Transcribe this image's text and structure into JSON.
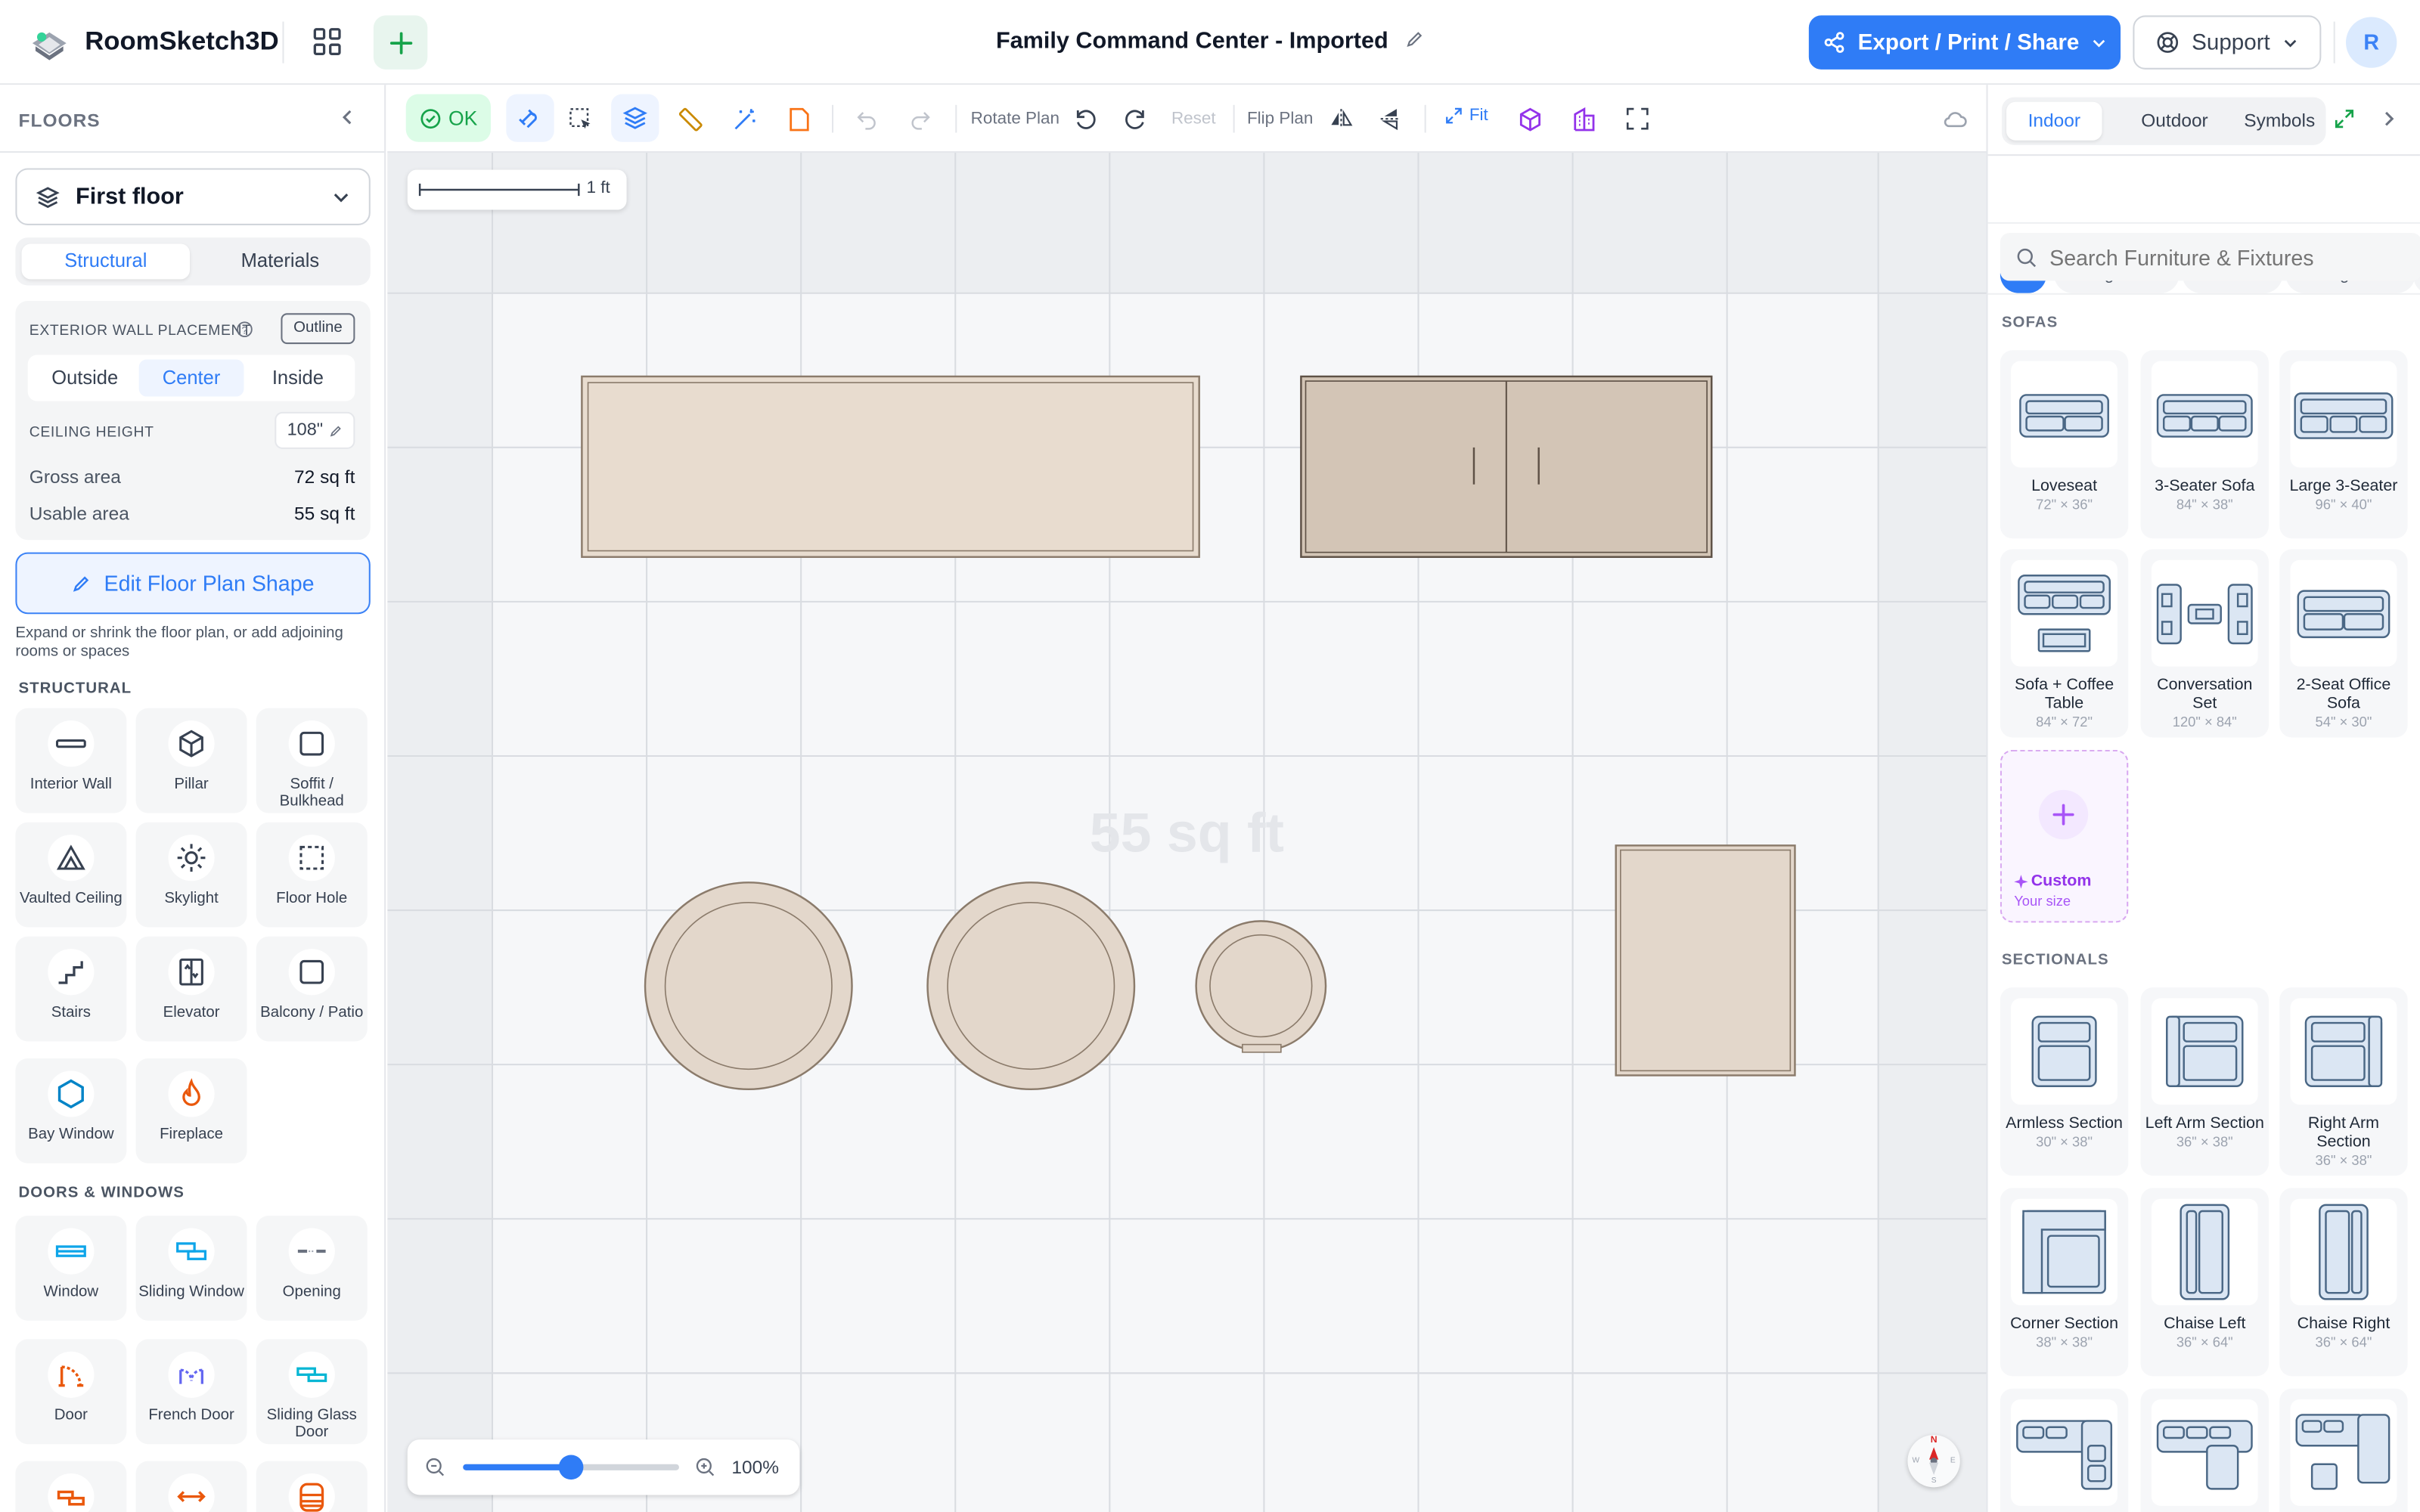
{
  "app": {
    "name": "RoomSketch3D",
    "doc_title": "Family Command Center - Imported",
    "avatar": "R"
  },
  "header": {
    "export_label": "Export / Print / Share",
    "support_label": "Support"
  },
  "left": {
    "floors_label": "FLOORS",
    "floor_select": "First floor",
    "tabs": [
      "Structural",
      "Materials"
    ],
    "wall_placement_label": "EXTERIOR WALL PLACEMENT",
    "outline_label": "Outline",
    "placement_options": [
      "Outside",
      "Center",
      "Inside"
    ],
    "ceiling_label": "CEILING HEIGHT",
    "ceiling_value": "108\"",
    "gross_label": "Gross area",
    "gross_value": "72 sq ft",
    "usable_label": "Usable area",
    "usable_value": "55 sq ft",
    "edit_button": "Edit Floor Plan Shape",
    "edit_hint": "Expand or shrink the floor plan, or add adjoining rooms or spaces",
    "structural_label": "STRUCTURAL",
    "structural_items": [
      "Interior Wall",
      "Pillar",
      "Soffit / Bulkhead",
      "Vaulted Ceiling",
      "Skylight",
      "Floor Hole",
      "Stairs",
      "Elevator",
      "Balcony / Patio",
      "Bay Window",
      "Fireplace"
    ],
    "doors_label": "DOORS & WINDOWS",
    "door_items": [
      "Window",
      "Sliding Window",
      "Opening",
      "Door",
      "French Door",
      "Sliding Glass Door"
    ]
  },
  "toolbar": {
    "ok": "OK",
    "rotate_label": "Rotate Plan",
    "reset_label": "Reset",
    "flip_label": "Flip Plan",
    "fit_label": "Fit"
  },
  "canvas": {
    "scale_label": "1 ft",
    "area_watermark": "55 sq ft",
    "zoom": "100%",
    "zoom_fraction": 0.5,
    "compass": {
      "n": "N",
      "w": "W",
      "e": "E",
      "s": "S"
    }
  },
  "right": {
    "tabs": [
      "Indoor",
      "Outdoor",
      "Symbols"
    ],
    "chips": [
      "All",
      "Living Room",
      "Bedroom",
      "Dining Room"
    ],
    "search_placeholder": "Search Furniture & Fixtures",
    "sofas_label": "SOFAS",
    "sofas": [
      {
        "name": "Loveseat",
        "dims": "72\" × 36\""
      },
      {
        "name": "3-Seater Sofa",
        "dims": "84\" × 38\""
      },
      {
        "name": "Large 3-Seater",
        "dims": "96\" × 40\""
      },
      {
        "name": "Sofa + Coffee Table",
        "dims": "84\" × 72\""
      },
      {
        "name": "Conversation Set",
        "dims": "120\" × 84\""
      },
      {
        "name": "2-Seat Office Sofa",
        "dims": "54\" × 30\""
      }
    ],
    "custom_label": "Custom",
    "custom_sub": "Your size",
    "sectionals_label": "SECTIONALS",
    "sectionals": [
      {
        "name": "Armless Section",
        "dims": "30\" × 38\""
      },
      {
        "name": "Left Arm Section",
        "dims": "36\" × 38\""
      },
      {
        "name": "Right Arm Section",
        "dims": "36\" × 38\""
      },
      {
        "name": "Corner Section",
        "dims": "38\" × 38\""
      },
      {
        "name": "Chaise Left",
        "dims": "36\" × 64\""
      },
      {
        "name": "Chaise Right",
        "dims": "36\" × 64\""
      }
    ]
  }
}
